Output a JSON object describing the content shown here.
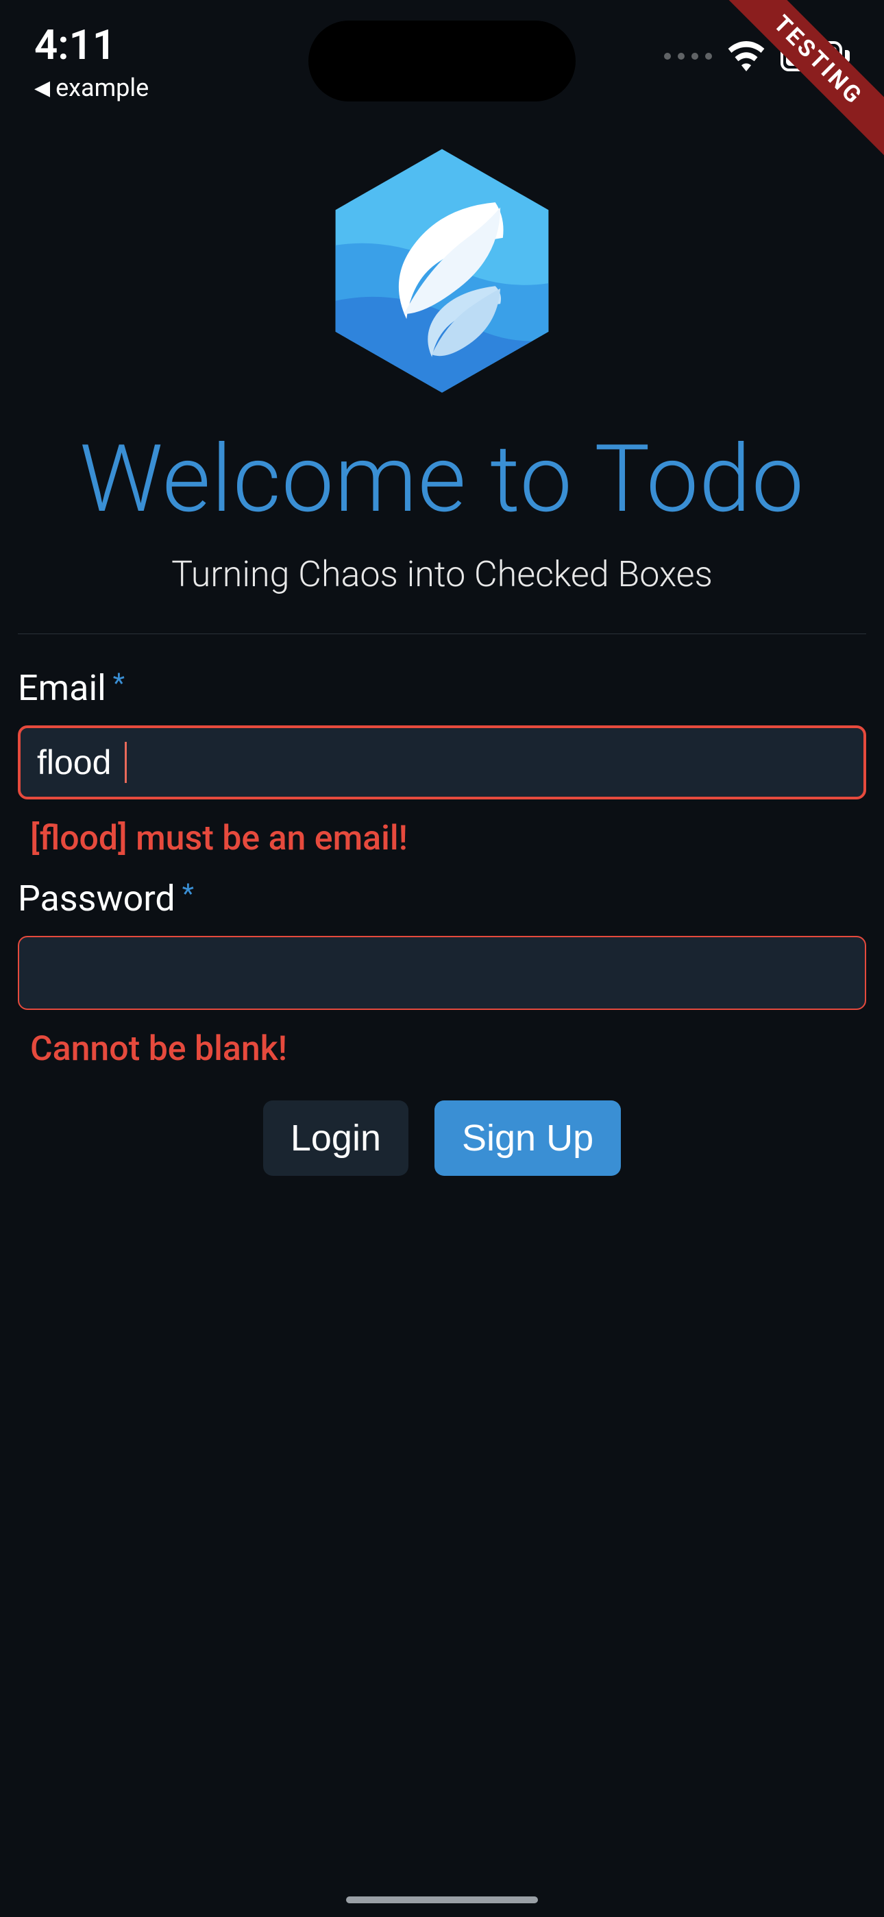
{
  "status": {
    "time": "4:11",
    "back_app": "example"
  },
  "ribbon": {
    "label": "TESTING"
  },
  "header": {
    "title": "Welcome to Todo",
    "subtitle": "Turning Chaos into Checked Boxes"
  },
  "form": {
    "email": {
      "label": "Email",
      "required_mark": "*",
      "value": "flood",
      "error": "[flood] must be an email!"
    },
    "password": {
      "label": "Password",
      "required_mark": "*",
      "value": "",
      "error": "Cannot be blank!"
    },
    "buttons": {
      "login": "Login",
      "signup": "Sign Up"
    }
  },
  "colors": {
    "accent": "#3a8fd4",
    "error": "#e64a3d",
    "background": "#0b0f14",
    "input_bg": "#192430"
  }
}
